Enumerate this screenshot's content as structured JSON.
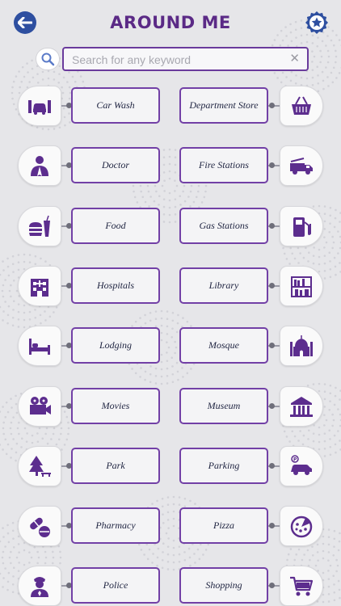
{
  "header": {
    "title": "AROUND ME",
    "back_icon": "back-arrow-icon",
    "favorite_icon": "star-badge-icon"
  },
  "search": {
    "placeholder": "Search for any keyword",
    "value": "",
    "clear": "✕"
  },
  "colors": {
    "primary": "#5b2a86",
    "accent_blue": "#2e4fa0",
    "icon": "#5c2d8e"
  },
  "categories": [
    {
      "label": "Car Wash",
      "icon": "car-wash-icon"
    },
    {
      "label": "Department Store",
      "icon": "basket-icon"
    },
    {
      "label": "Doctor",
      "icon": "doctor-icon"
    },
    {
      "label": "Fire Stations",
      "icon": "fire-truck-icon"
    },
    {
      "label": "Food",
      "icon": "food-icon"
    },
    {
      "label": "Gas Stations",
      "icon": "gas-pump-icon"
    },
    {
      "label": "Hospitals",
      "icon": "hospital-icon"
    },
    {
      "label": "Library",
      "icon": "bookshelf-icon"
    },
    {
      "label": "Lodging",
      "icon": "bed-icon"
    },
    {
      "label": "Mosque",
      "icon": "mosque-icon"
    },
    {
      "label": "Movies",
      "icon": "movie-camera-icon"
    },
    {
      "label": "Museum",
      "icon": "museum-icon"
    },
    {
      "label": "Park",
      "icon": "tree-icon"
    },
    {
      "label": "Parking",
      "icon": "parking-car-icon"
    },
    {
      "label": "Pharmacy",
      "icon": "pills-icon"
    },
    {
      "label": "Pizza",
      "icon": "pizza-icon"
    },
    {
      "label": "Police",
      "icon": "police-icon"
    },
    {
      "label": "Shopping",
      "icon": "shopping-cart-icon"
    }
  ]
}
